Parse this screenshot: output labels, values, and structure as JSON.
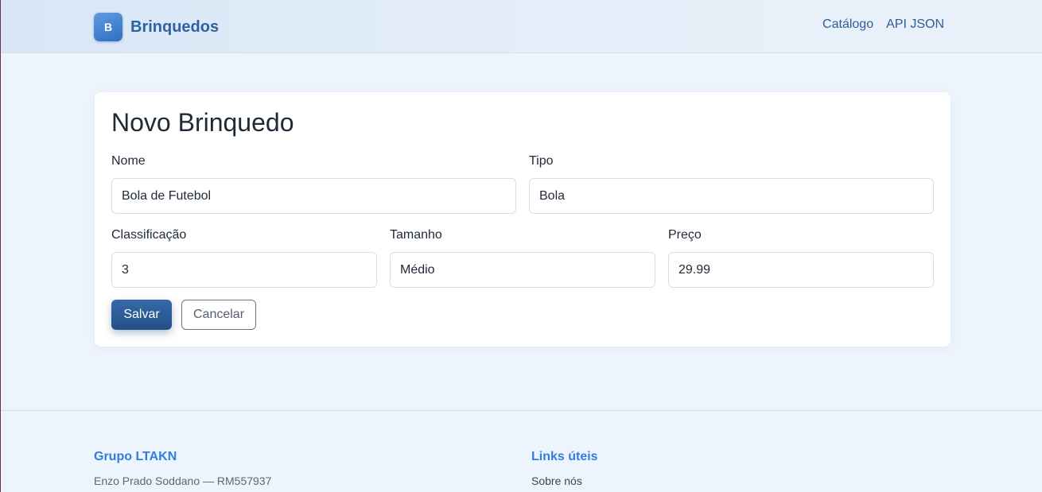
{
  "navbar": {
    "logo_letter": "B",
    "brand": "Brinquedos",
    "links": [
      {
        "label": "Catálogo"
      },
      {
        "label": "API JSON"
      }
    ]
  },
  "form": {
    "title": "Novo Brinquedo",
    "fields": {
      "nome": {
        "label": "Nome",
        "value": "Bola de Futebol"
      },
      "tipo": {
        "label": "Tipo",
        "value": "Bola"
      },
      "classificacao": {
        "label": "Classificação",
        "value": "3"
      },
      "tamanho": {
        "label": "Tamanho",
        "value": "Médio"
      },
      "preco": {
        "label": "Preço",
        "value": "29.99"
      }
    },
    "save_label": "Salvar",
    "cancel_label": "Cancelar"
  },
  "footer": {
    "group": {
      "heading": "Grupo LTAKN",
      "member": "Enzo Prado Soddano — RM557937"
    },
    "links": {
      "heading": "Links úteis",
      "items": [
        {
          "label": "Sobre nós"
        }
      ]
    }
  },
  "colors": {
    "brand": "#2e62a3",
    "primary_button": "#2c5c99",
    "footer_heading": "#2f7de0",
    "page_background": "#eef4fc"
  }
}
